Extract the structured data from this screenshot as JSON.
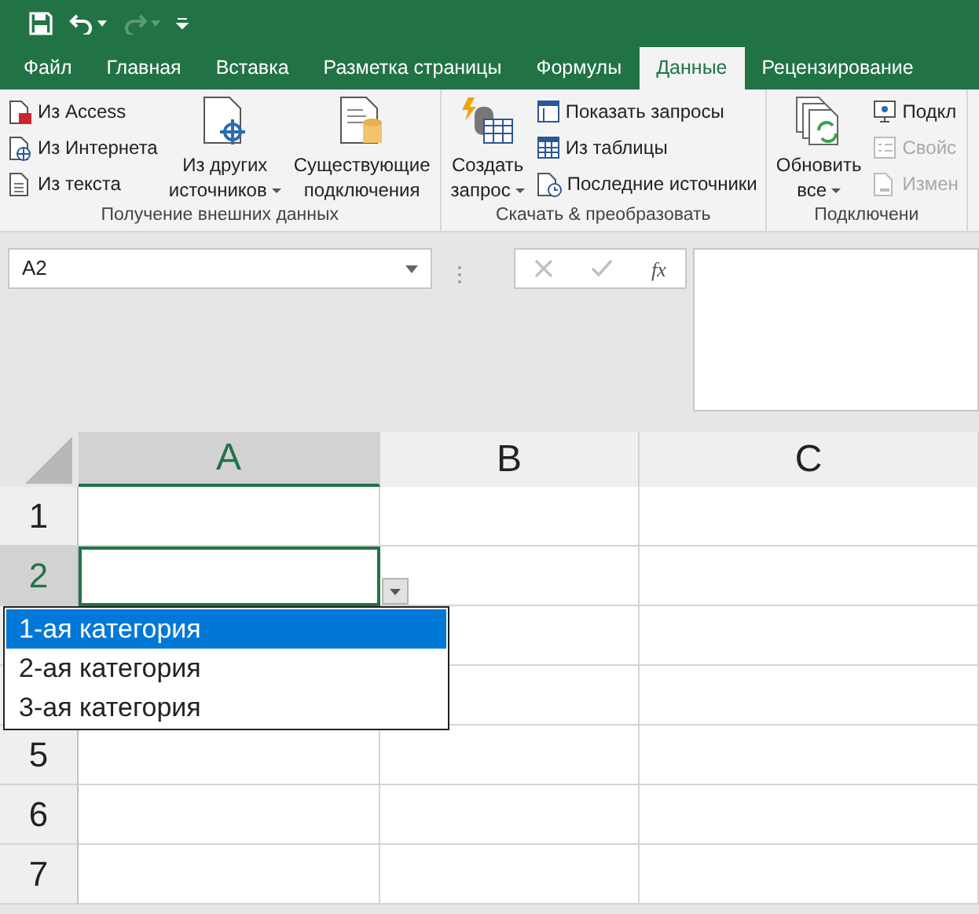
{
  "quick_access": [
    {
      "kind": "save",
      "disabled": false
    },
    {
      "kind": "undo",
      "disabled": false
    },
    {
      "kind": "redo",
      "disabled": true
    },
    {
      "kind": "customize",
      "disabled": false
    }
  ],
  "tabs": [
    {
      "label": "Файл",
      "selected": false
    },
    {
      "label": "Главная",
      "selected": false
    },
    {
      "label": "Вставка",
      "selected": false
    },
    {
      "label": "Разметка страницы",
      "selected": false
    },
    {
      "label": "Формулы",
      "selected": false
    },
    {
      "label": "Данные",
      "selected": true
    },
    {
      "label": "Рецензирование",
      "selected": false
    }
  ],
  "ribbon": {
    "groups": [
      {
        "label": "Получение внешних данных",
        "items": [
          {
            "kind": "small",
            "label": "Из Access",
            "disabled": false
          },
          {
            "kind": "small",
            "label": "Из Интернета",
            "disabled": false
          },
          {
            "kind": "small",
            "label": "Из текста",
            "disabled": false
          },
          {
            "kind": "large",
            "lines": [
              "Из других",
              "источников"
            ],
            "dropdown": true,
            "disabled": false
          },
          {
            "kind": "large",
            "lines": [
              "Существующие",
              "подключения"
            ],
            "dropdown": false,
            "disabled": false
          }
        ]
      },
      {
        "label": "Скачать & преобразовать",
        "items": [
          {
            "kind": "large",
            "lines": [
              "Создать",
              "запрос"
            ],
            "dropdown": true,
            "disabled": false
          },
          {
            "kind": "small",
            "label": "Показать запросы",
            "disabled": false
          },
          {
            "kind": "small",
            "label": "Из таблицы",
            "disabled": false
          },
          {
            "kind": "small",
            "label": "Последние источники",
            "disabled": false
          }
        ]
      },
      {
        "label": "Подключени",
        "items": [
          {
            "kind": "large",
            "lines": [
              "Обновить",
              "все"
            ],
            "dropdown": true,
            "disabled": false
          },
          {
            "kind": "small",
            "label": "Подкл",
            "disabled": false
          },
          {
            "kind": "small",
            "label": "Свойс",
            "disabled": true
          },
          {
            "kind": "small",
            "label": "Измен",
            "disabled": true
          }
        ]
      }
    ]
  },
  "formula_bar": {
    "name_box": "A2",
    "cancel_disabled": true,
    "enter_disabled": true,
    "function_label": "fx"
  },
  "columns": [
    {
      "label": "A",
      "selected": true
    },
    {
      "label": "B",
      "selected": false
    },
    {
      "label": "C",
      "selected": false
    }
  ],
  "rows": [
    {
      "label": "1",
      "selected": false
    },
    {
      "label": "2",
      "selected": true
    },
    {},
    {},
    {
      "label": "5",
      "selected": false
    },
    {
      "label": "6",
      "selected": false
    },
    {
      "label": "7",
      "selected": false
    }
  ],
  "validation_list": {
    "items": [
      {
        "label": "1-ая категория",
        "selected": true
      },
      {
        "label": "2-ая категория",
        "selected": false
      },
      {
        "label": "3-ая категория",
        "selected": false
      }
    ]
  }
}
